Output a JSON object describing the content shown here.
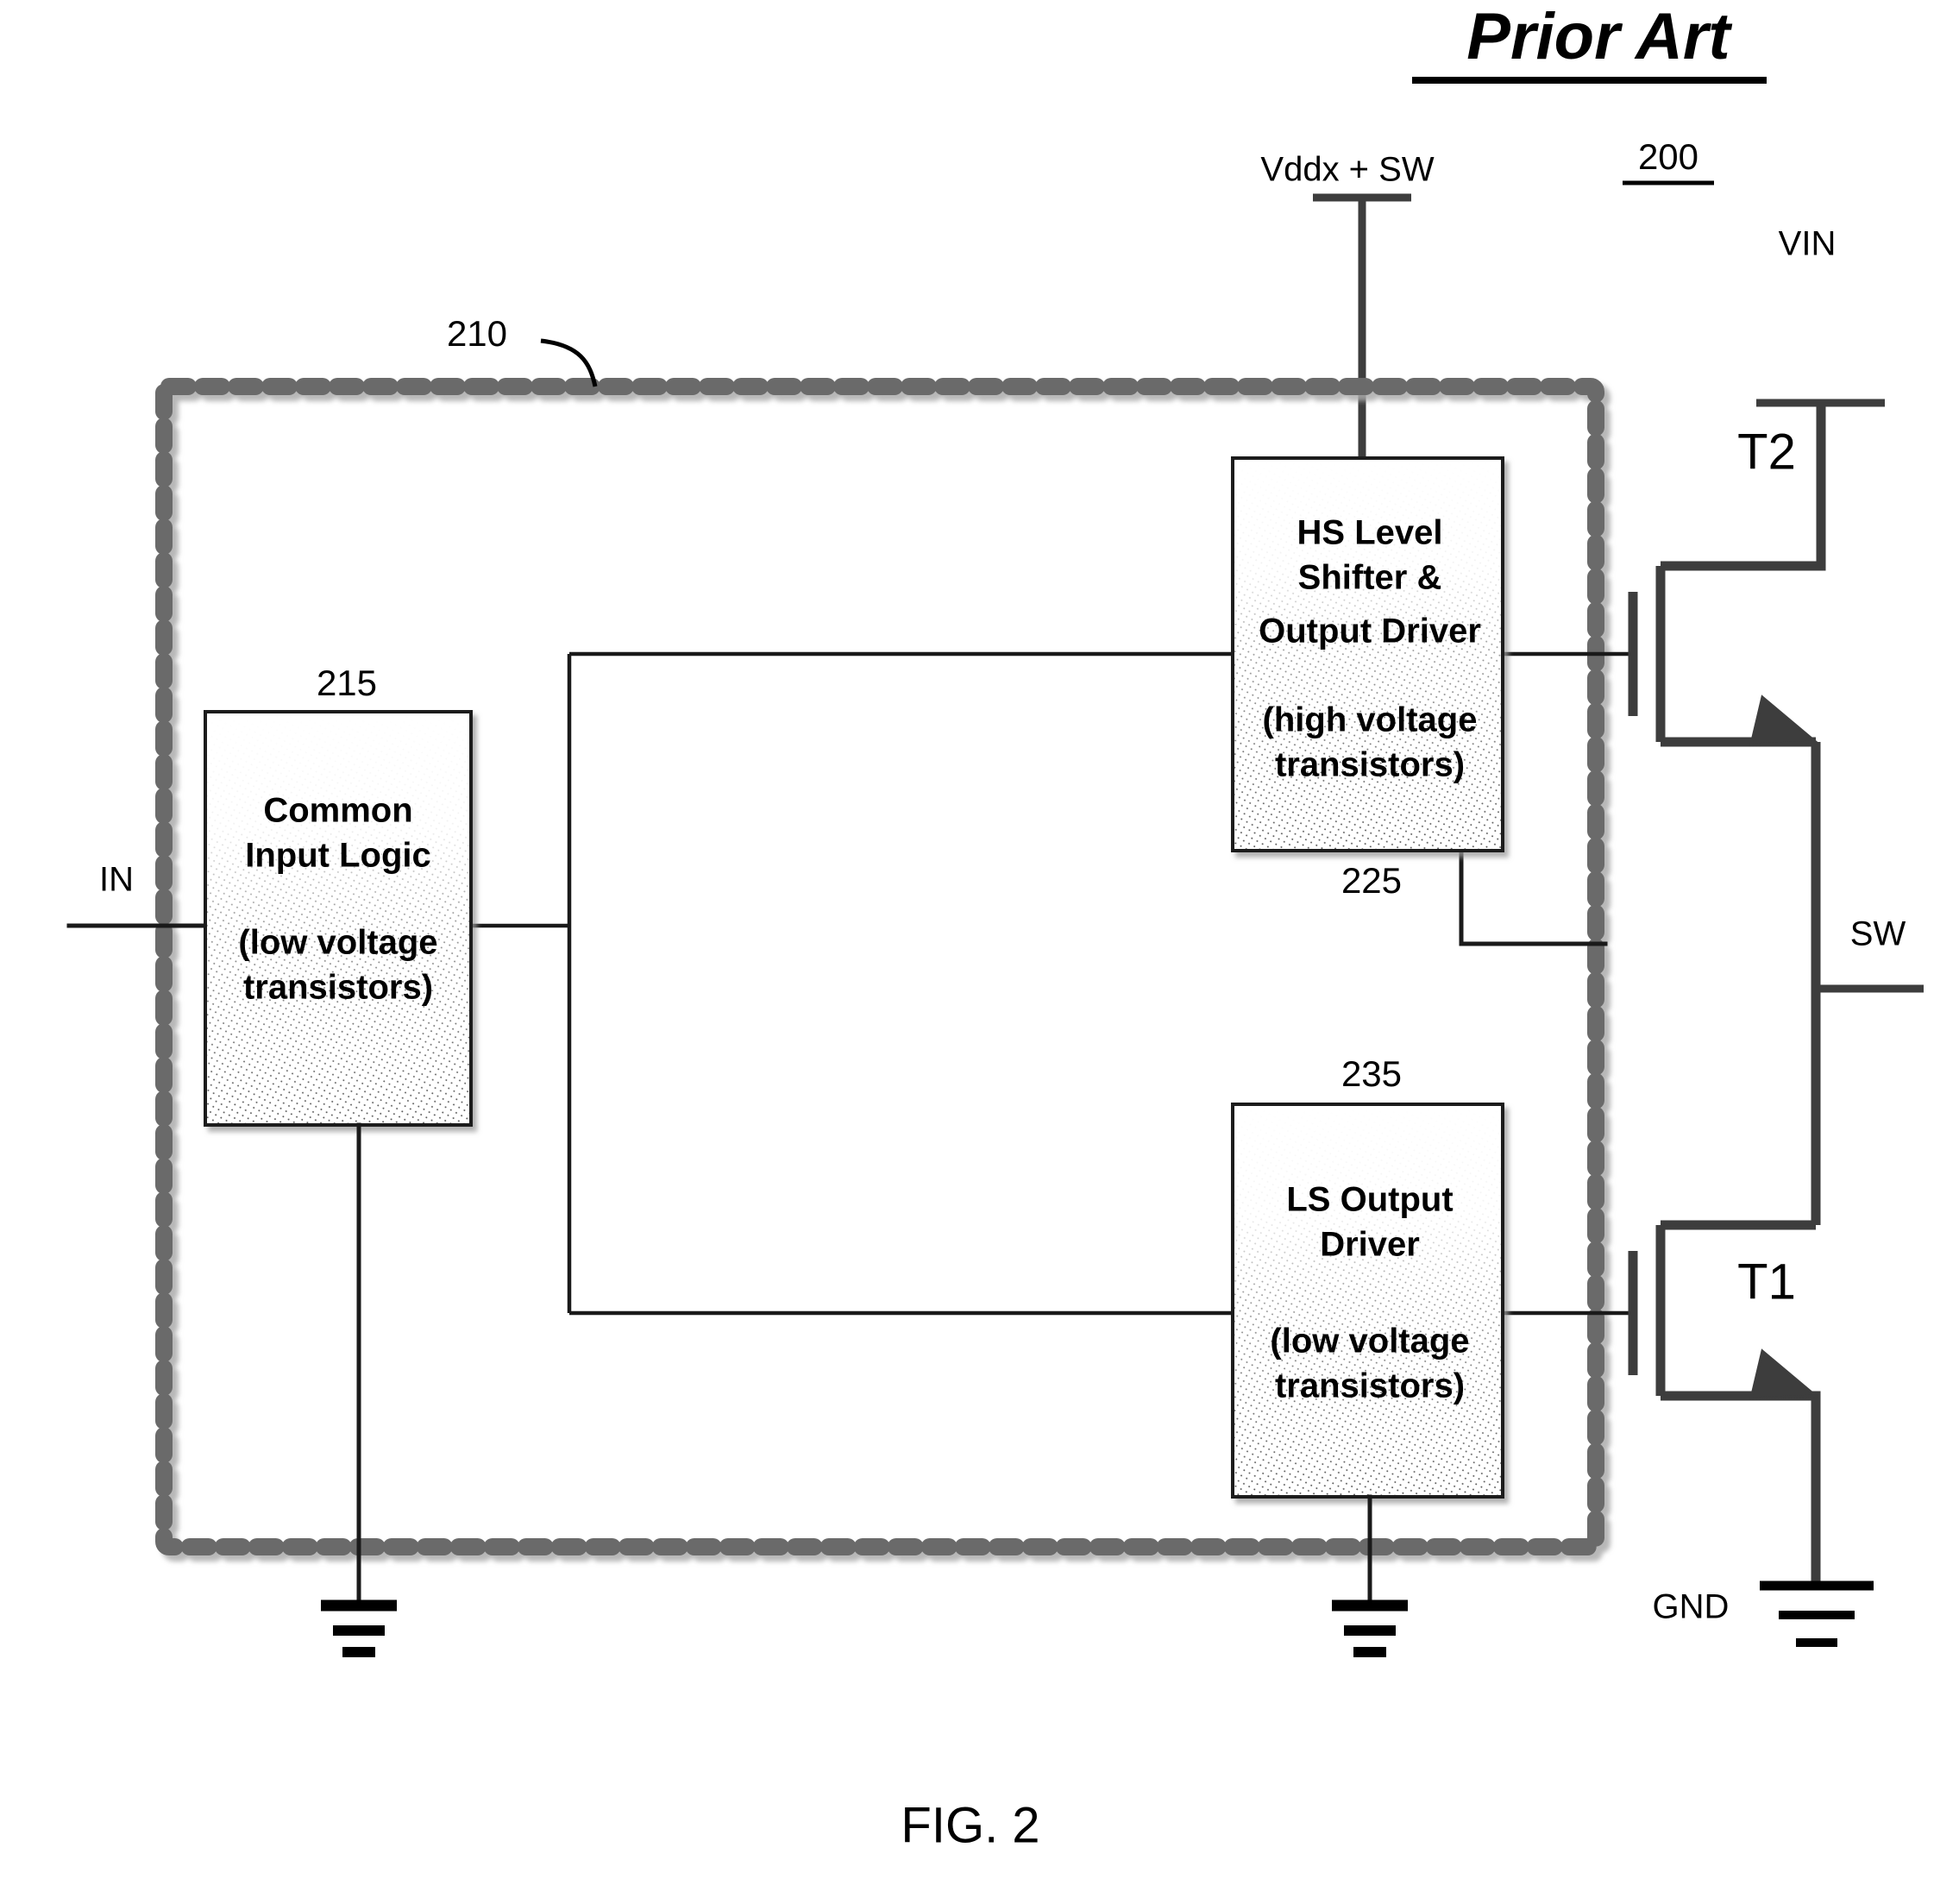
{
  "figure": {
    "prior_art_label": "Prior Art",
    "caption": "FIG. 2",
    "assembly_ref": "200",
    "region_ref": "210"
  },
  "blocks": [
    {
      "id": "common-input-logic",
      "ref": "215",
      "title_lines": [
        "Common",
        "Input Logic"
      ],
      "subtitle_lines": [
        "(low voltage",
        "transistors)"
      ]
    },
    {
      "id": "hs-level-shifter",
      "ref": "225",
      "title_lines": [
        "HS Level",
        "Shifter &",
        "Output Driver"
      ],
      "subtitle_lines": [
        "(high voltage",
        "transistors)"
      ]
    },
    {
      "id": "ls-output-driver",
      "ref": "235",
      "title_lines": [
        "LS Output",
        "Driver"
      ],
      "subtitle_lines": [
        "(low voltage",
        "transistors)"
      ]
    }
  ],
  "nodes": {
    "input": "IN",
    "supply_hs": "Vddx + SW",
    "supply_vin": "VIN",
    "switch": "SW",
    "ground": "GND"
  },
  "transistors": [
    {
      "id": "t2",
      "label": "T2"
    },
    {
      "id": "t1",
      "label": "T1"
    }
  ],
  "colors": {
    "ink": "#000000",
    "wire": "#1a1a1a",
    "power_wire": "#3d3d3d",
    "dashed_border": "#6b6b6b",
    "block_fill_light": "#ffffff",
    "block_fill_shade": "#e8e8e8"
  }
}
